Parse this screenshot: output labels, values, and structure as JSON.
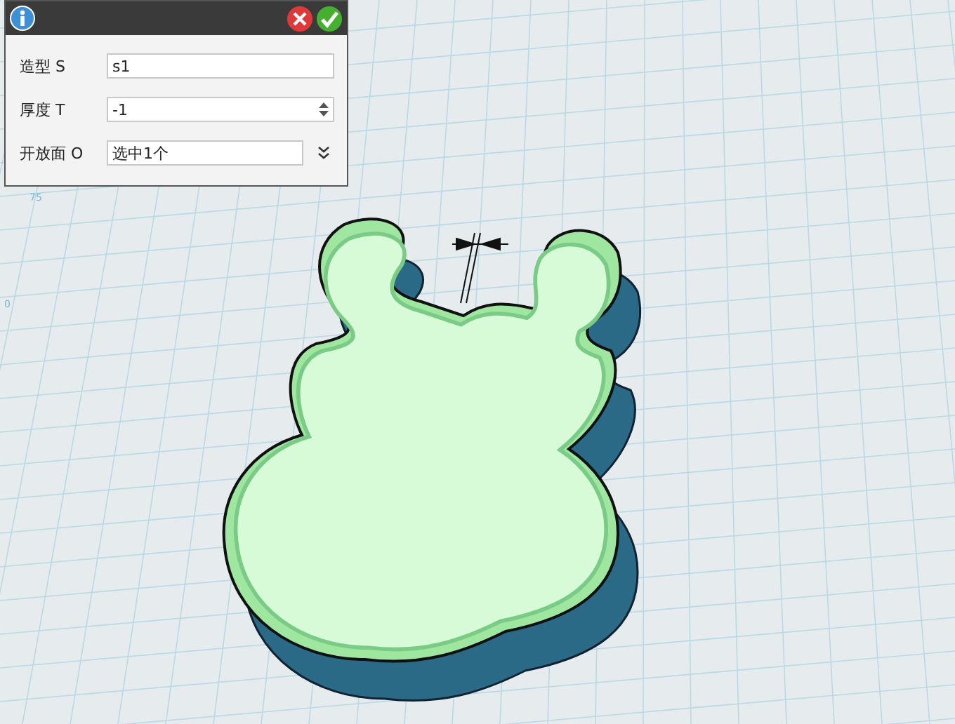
{
  "dialog": {
    "fields": [
      {
        "label": "造型 S",
        "value": "s1",
        "kind": "text"
      },
      {
        "label": "厚度 T",
        "value": "-1",
        "kind": "spinner"
      },
      {
        "label": "开放面 O",
        "value": "选中1个",
        "kind": "picker"
      }
    ]
  },
  "viewport": {
    "grid_labels": [
      "75",
      "0"
    ]
  }
}
